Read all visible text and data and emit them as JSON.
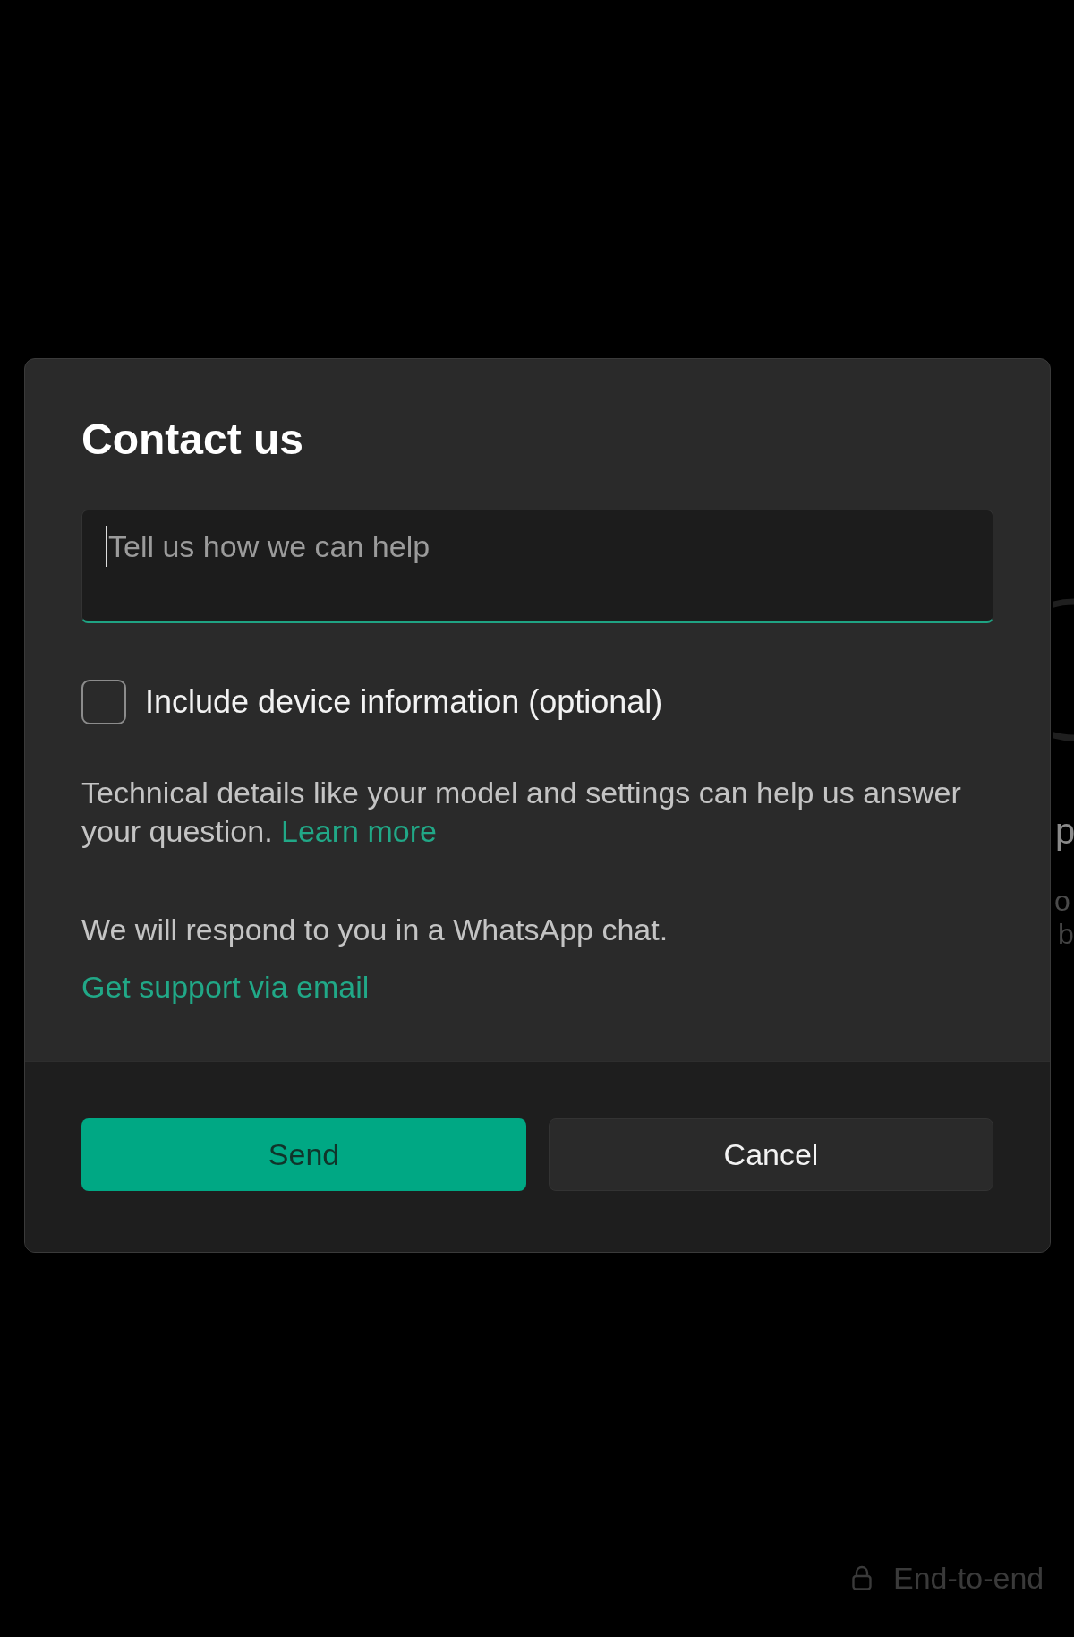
{
  "background": {
    "fragments": [
      "p",
      "o",
      "b"
    ],
    "footer_note": "End-to-end"
  },
  "dialog": {
    "title": "Contact us",
    "message_field": {
      "placeholder": "Tell us how we can help",
      "focused": true
    },
    "device_info_checkbox": {
      "label": "Include device information (optional)",
      "checked": false
    },
    "help_text": "Technical details like your model and settings can help us answer your question.",
    "help_link": "Learn more",
    "response_note": "We will respond to you in a WhatsApp chat.",
    "email_link": "Get support via email",
    "buttons": [
      {
        "label": "Send",
        "kind": "primary"
      },
      {
        "label": "Cancel",
        "kind": "secondary"
      }
    ]
  }
}
